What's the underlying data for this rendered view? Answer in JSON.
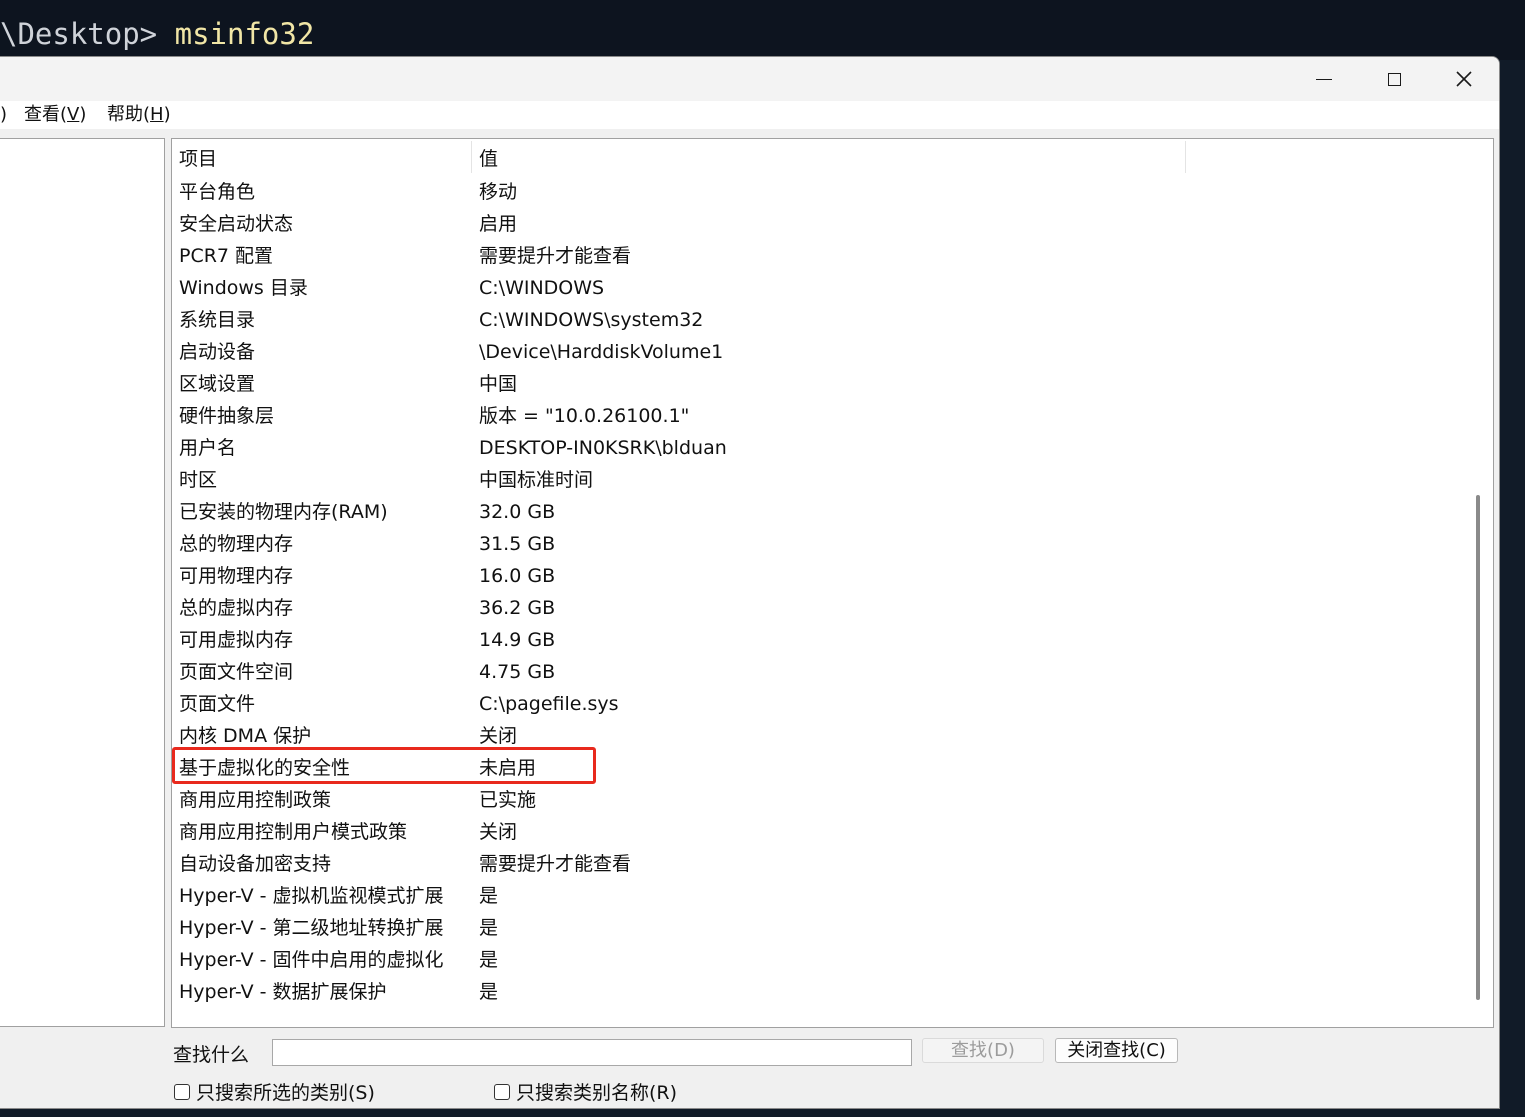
{
  "terminal": {
    "prompt": "\\Desktop> ",
    "command": "msinfo32"
  },
  "menubar": {
    "clipped_item": ")",
    "items": [
      {
        "label": "查看(",
        "mnemonic": "V",
        "tail": ")"
      },
      {
        "label": "帮助(",
        "mnemonic": "H",
        "tail": ")"
      }
    ]
  },
  "list": {
    "headers": {
      "item": "项目",
      "value": "值"
    },
    "rows": [
      {
        "item": "平台角色",
        "value": "移动"
      },
      {
        "item": "安全启动状态",
        "value": "启用"
      },
      {
        "item": "PCR7 配置",
        "value": "需要提升才能查看"
      },
      {
        "item": "Windows 目录",
        "value": "C:\\WINDOWS"
      },
      {
        "item": "系统目录",
        "value": "C:\\WINDOWS\\system32"
      },
      {
        "item": "启动设备",
        "value": "\\Device\\HarddiskVolume1"
      },
      {
        "item": "区域设置",
        "value": "中国"
      },
      {
        "item": "硬件抽象层",
        "value": "版本 = \"10.0.26100.1\""
      },
      {
        "item": "用户名",
        "value": "DESKTOP-IN0KSRK\\blduan"
      },
      {
        "item": "时区",
        "value": "中国标准时间"
      },
      {
        "item": "已安装的物理内存(RAM)",
        "value": "32.0 GB"
      },
      {
        "item": "总的物理内存",
        "value": "31.5 GB"
      },
      {
        "item": "可用物理内存",
        "value": "16.0 GB"
      },
      {
        "item": "总的虚拟内存",
        "value": "36.2 GB"
      },
      {
        "item": "可用虚拟内存",
        "value": "14.9 GB"
      },
      {
        "item": "页面文件空间",
        "value": "4.75 GB"
      },
      {
        "item": "页面文件",
        "value": "C:\\pagefile.sys"
      },
      {
        "item": "内核 DMA 保护",
        "value": "关闭"
      },
      {
        "item": "基于虚拟化的安全性",
        "value": "未启用"
      },
      {
        "item": "商用应用控制政策",
        "value": "已实施"
      },
      {
        "item": "商用应用控制用户模式政策",
        "value": "关闭"
      },
      {
        "item": "自动设备加密支持",
        "value": "需要提升才能查看"
      },
      {
        "item": "Hyper-V - 虚拟机监视模式扩展",
        "value": "是"
      },
      {
        "item": "Hyper-V - 第二级地址转换扩展",
        "value": "是"
      },
      {
        "item": "Hyper-V - 固件中启用的虚拟化",
        "value": "是"
      },
      {
        "item": "Hyper-V - 数据扩展保护",
        "value": "是"
      }
    ],
    "highlighted_row_index": 18,
    "highlight_color": "#e8291d"
  },
  "find": {
    "label": "查找什么",
    "input_value": "",
    "find_button": "查找(D)",
    "close_button": "关闭查找(C)",
    "only_selected_category": "只搜索所选的类别(S)",
    "only_category_names": "只搜索类别名称(R)"
  },
  "window": {
    "minimize_icon": "minimize-icon",
    "maximize_icon": "maximize-icon",
    "close_icon": "close-icon"
  }
}
